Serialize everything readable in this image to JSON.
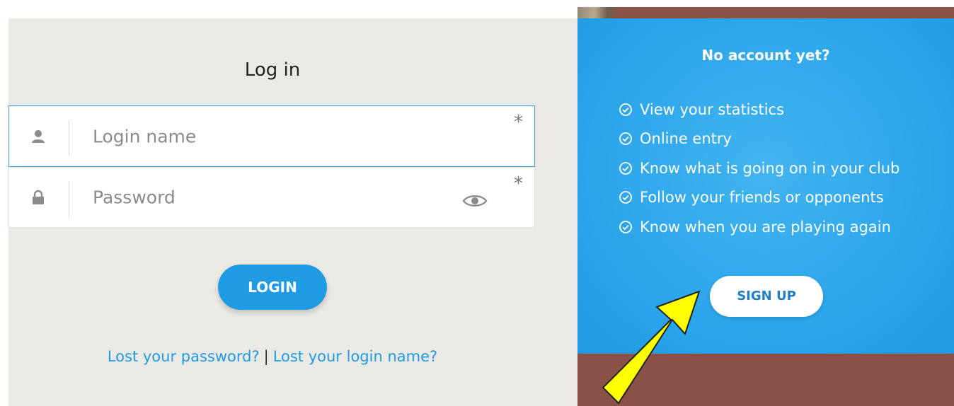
{
  "login": {
    "title": "Log in",
    "login_name_placeholder": "Login name",
    "password_placeholder": "Password",
    "required_marker": "*",
    "login_button": "LOGIN",
    "lost_password_link": "Lost your password?",
    "separator": "|",
    "lost_login_link": "Lost your login name?"
  },
  "signup": {
    "title": "No account yet?",
    "benefits": [
      "View your statistics",
      "Online entry",
      "Know what is going on in your club",
      "Follow your friends or opponents",
      "Know when you are playing again"
    ],
    "button": "SIGN UP"
  },
  "icons": {
    "user": "user-icon",
    "lock": "lock-icon",
    "eye": "eye-icon",
    "check": "check-circle-icon",
    "annotation": "yellow-arrow-icon"
  },
  "colors": {
    "accent_blue": "#1e9be3",
    "login_panel_bg": "#ebe9e4",
    "annotation_yellow": "#ffff00"
  }
}
